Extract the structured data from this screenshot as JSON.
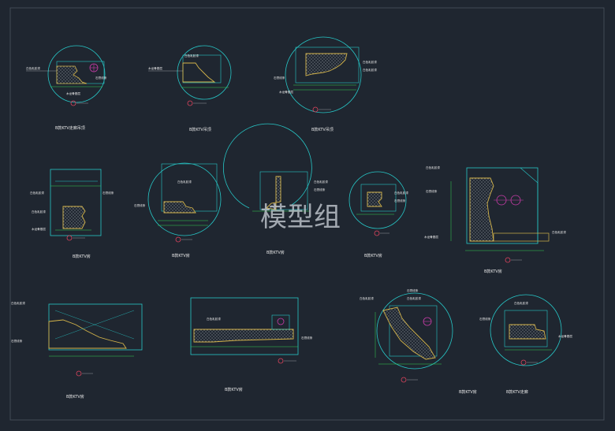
{
  "watermark": "模型组",
  "captions": [
    "B款KTV走廊吊顶",
    "B款KTV吊顶",
    "B款KTV吊顶",
    "B款KTV房",
    "B款KTV房",
    "B款KTV房",
    "B款KTV房",
    "B款KTV房",
    "B款KTV房",
    "B款KTV房",
    "B款KTV房",
    "B款KTV走廊"
  ],
  "notes": {
    "d1": [
      "白色乳胶漆",
      "石膏线条",
      "木龙骨基层"
    ],
    "d2": [
      "木龙骨基层",
      "白色乳胶漆"
    ],
    "d3": [
      "白色乳胶漆",
      "石膏线条",
      "木龙骨基层",
      "白色乳胶漆"
    ],
    "d4": [
      "白色乳胶漆",
      "石膏线条",
      "白色乳胶漆",
      "木龙骨基层"
    ],
    "d5": [
      "白色乳胶漆",
      "石膏线条"
    ],
    "d6": [
      "白色乳胶漆",
      "石膏线条"
    ],
    "d7": [
      "白色乳胶漆",
      "石膏线条"
    ],
    "d8": [
      "白色乳胶漆",
      "石膏线条",
      "木龙骨基层",
      "白色乳胶漆"
    ],
    "d9": [
      "白色乳胶漆",
      "石膏线条"
    ],
    "d10": [
      "白色乳胶漆",
      "石膏线条"
    ],
    "d11": [
      "白色乳胶漆",
      "石膏线条",
      "白色乳胶漆"
    ],
    "d12": [
      "白色乳胶漆",
      "石膏线条",
      "木龙骨基层"
    ]
  },
  "colors": {
    "background": "#1f2630",
    "frame": "#27c6c6",
    "profile": "#d4b44a",
    "dimension": "#36d24f",
    "annotation": "#e8e8e8",
    "marker": "#e0445e",
    "accent": "#c83ca8"
  }
}
